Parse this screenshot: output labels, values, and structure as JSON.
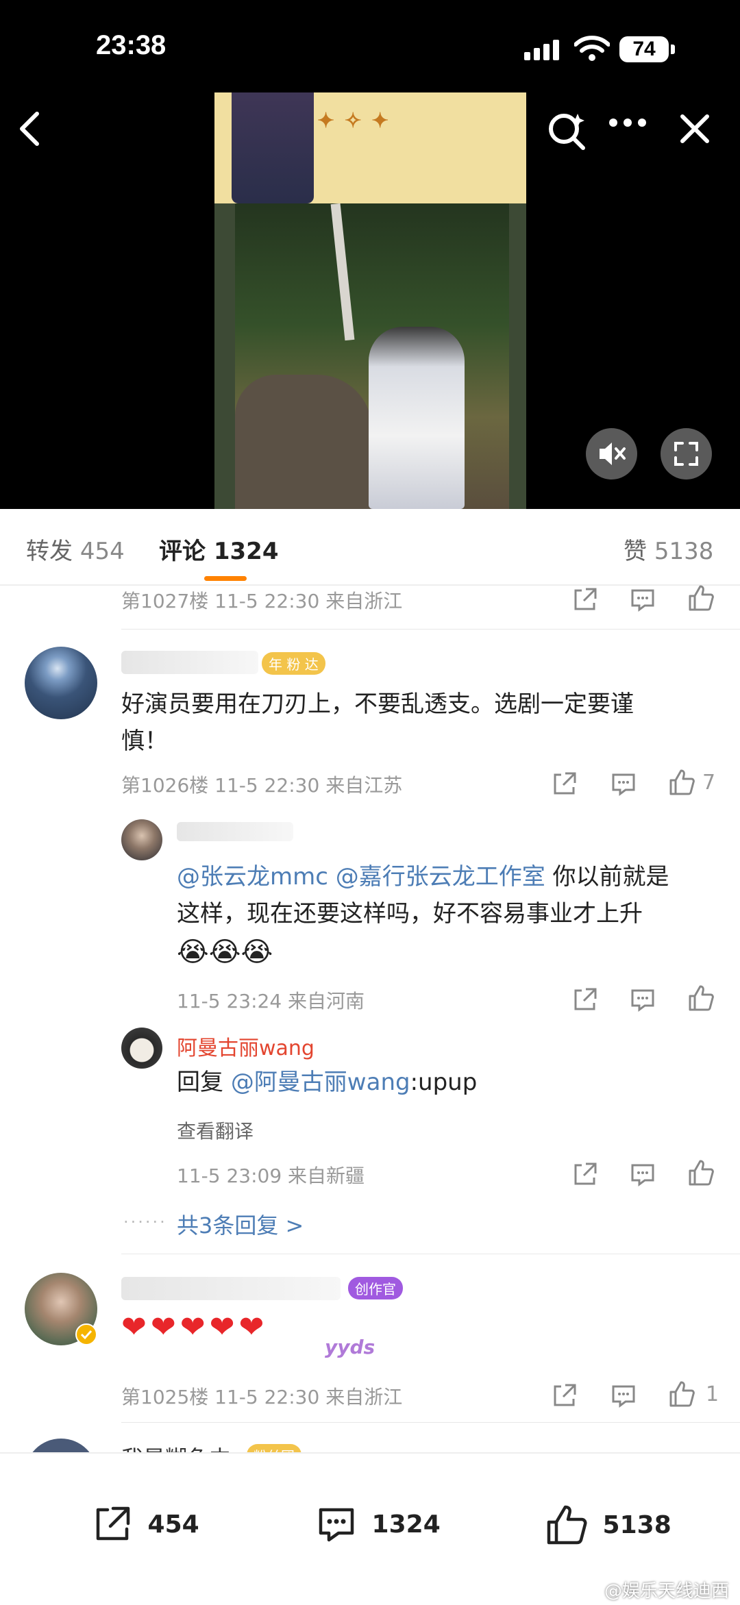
{
  "status_bar": {
    "time": "23:38",
    "battery": "74"
  },
  "tabs": {
    "repost_label": "转发",
    "repost_count": "454",
    "comment_label": "评论",
    "comment_count": "1324",
    "like_label": "赞",
    "like_count": "5138"
  },
  "comments": [
    {
      "meta": "第1027楼 11-5 22:30 来自浙江"
    },
    {
      "badge": "年 粉 达",
      "text_line1": "好演员要用在刀刃上，不要乱透支。选剧一定要谨",
      "text_line2": "慎！",
      "meta": "第1026楼 11-5 22:30 来自江苏",
      "like_count": "7"
    },
    {
      "mention1": "@张云龙mmc",
      "mention2": "@嘉行张云龙工作室",
      "text_a": " 你以前就是",
      "text_line2": "这样，现在还要这样吗，好不容易事业才上升",
      "emoji": "😭😭😭",
      "meta": "11-5 23:24 来自河南"
    },
    {
      "name": "阿曼古丽wang",
      "reply_prefix": "回复 ",
      "reply_mention": "@阿曼古丽wang",
      "reply_text": ":upup",
      "translate": "查看翻译",
      "meta": "11-5 23:09 来自新疆"
    },
    {
      "more_replies": "共3条回复 >"
    },
    {
      "badge": "创作官",
      "hearts": "❤❤❤❤❤",
      "sticker": "yyds",
      "meta": "第1025楼 11-5 22:30 来自浙江",
      "like_count": "1"
    },
    {
      "partial_name": "我是糊鱼中",
      "badge": "粉丝团"
    }
  ],
  "bottom_bar": {
    "repost": "454",
    "comment": "1324",
    "like": "5138"
  },
  "watermark": "@娱乐天线迪西"
}
